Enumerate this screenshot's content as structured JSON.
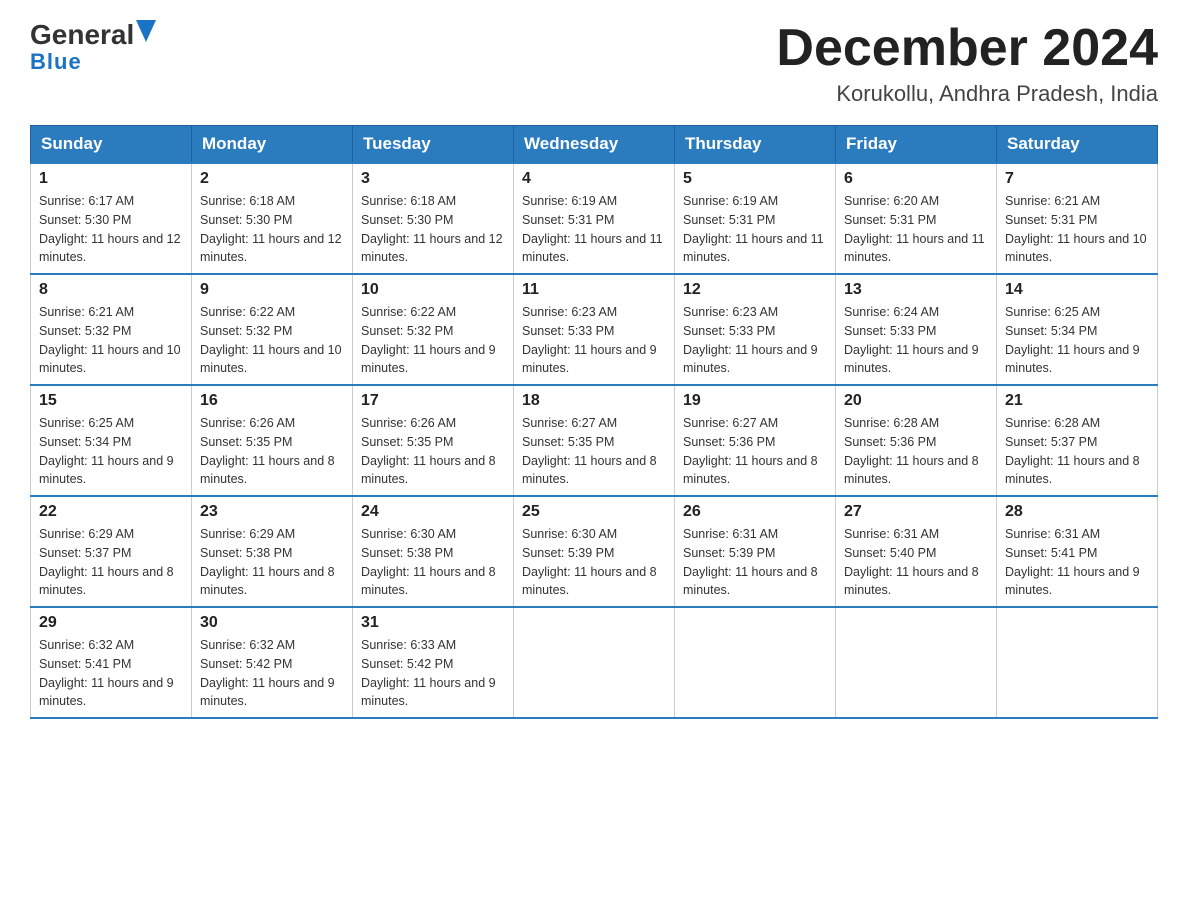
{
  "header": {
    "logo_general": "General",
    "logo_blue": "Blue",
    "month_title": "December 2024",
    "location": "Korukollu, Andhra Pradesh, India"
  },
  "days_of_week": [
    "Sunday",
    "Monday",
    "Tuesday",
    "Wednesday",
    "Thursday",
    "Friday",
    "Saturday"
  ],
  "weeks": [
    [
      {
        "day": "1",
        "sunrise": "6:17 AM",
        "sunset": "5:30 PM",
        "daylight": "11 hours and 12 minutes."
      },
      {
        "day": "2",
        "sunrise": "6:18 AM",
        "sunset": "5:30 PM",
        "daylight": "11 hours and 12 minutes."
      },
      {
        "day": "3",
        "sunrise": "6:18 AM",
        "sunset": "5:30 PM",
        "daylight": "11 hours and 12 minutes."
      },
      {
        "day": "4",
        "sunrise": "6:19 AM",
        "sunset": "5:31 PM",
        "daylight": "11 hours and 11 minutes."
      },
      {
        "day": "5",
        "sunrise": "6:19 AM",
        "sunset": "5:31 PM",
        "daylight": "11 hours and 11 minutes."
      },
      {
        "day": "6",
        "sunrise": "6:20 AM",
        "sunset": "5:31 PM",
        "daylight": "11 hours and 11 minutes."
      },
      {
        "day": "7",
        "sunrise": "6:21 AM",
        "sunset": "5:31 PM",
        "daylight": "11 hours and 10 minutes."
      }
    ],
    [
      {
        "day": "8",
        "sunrise": "6:21 AM",
        "sunset": "5:32 PM",
        "daylight": "11 hours and 10 minutes."
      },
      {
        "day": "9",
        "sunrise": "6:22 AM",
        "sunset": "5:32 PM",
        "daylight": "11 hours and 10 minutes."
      },
      {
        "day": "10",
        "sunrise": "6:22 AM",
        "sunset": "5:32 PM",
        "daylight": "11 hours and 9 minutes."
      },
      {
        "day": "11",
        "sunrise": "6:23 AM",
        "sunset": "5:33 PM",
        "daylight": "11 hours and 9 minutes."
      },
      {
        "day": "12",
        "sunrise": "6:23 AM",
        "sunset": "5:33 PM",
        "daylight": "11 hours and 9 minutes."
      },
      {
        "day": "13",
        "sunrise": "6:24 AM",
        "sunset": "5:33 PM",
        "daylight": "11 hours and 9 minutes."
      },
      {
        "day": "14",
        "sunrise": "6:25 AM",
        "sunset": "5:34 PM",
        "daylight": "11 hours and 9 minutes."
      }
    ],
    [
      {
        "day": "15",
        "sunrise": "6:25 AM",
        "sunset": "5:34 PM",
        "daylight": "11 hours and 9 minutes."
      },
      {
        "day": "16",
        "sunrise": "6:26 AM",
        "sunset": "5:35 PM",
        "daylight": "11 hours and 8 minutes."
      },
      {
        "day": "17",
        "sunrise": "6:26 AM",
        "sunset": "5:35 PM",
        "daylight": "11 hours and 8 minutes."
      },
      {
        "day": "18",
        "sunrise": "6:27 AM",
        "sunset": "5:35 PM",
        "daylight": "11 hours and 8 minutes."
      },
      {
        "day": "19",
        "sunrise": "6:27 AM",
        "sunset": "5:36 PM",
        "daylight": "11 hours and 8 minutes."
      },
      {
        "day": "20",
        "sunrise": "6:28 AM",
        "sunset": "5:36 PM",
        "daylight": "11 hours and 8 minutes."
      },
      {
        "day": "21",
        "sunrise": "6:28 AM",
        "sunset": "5:37 PM",
        "daylight": "11 hours and 8 minutes."
      }
    ],
    [
      {
        "day": "22",
        "sunrise": "6:29 AM",
        "sunset": "5:37 PM",
        "daylight": "11 hours and 8 minutes."
      },
      {
        "day": "23",
        "sunrise": "6:29 AM",
        "sunset": "5:38 PM",
        "daylight": "11 hours and 8 minutes."
      },
      {
        "day": "24",
        "sunrise": "6:30 AM",
        "sunset": "5:38 PM",
        "daylight": "11 hours and 8 minutes."
      },
      {
        "day": "25",
        "sunrise": "6:30 AM",
        "sunset": "5:39 PM",
        "daylight": "11 hours and 8 minutes."
      },
      {
        "day": "26",
        "sunrise": "6:31 AM",
        "sunset": "5:39 PM",
        "daylight": "11 hours and 8 minutes."
      },
      {
        "day": "27",
        "sunrise": "6:31 AM",
        "sunset": "5:40 PM",
        "daylight": "11 hours and 8 minutes."
      },
      {
        "day": "28",
        "sunrise": "6:31 AM",
        "sunset": "5:41 PM",
        "daylight": "11 hours and 9 minutes."
      }
    ],
    [
      {
        "day": "29",
        "sunrise": "6:32 AM",
        "sunset": "5:41 PM",
        "daylight": "11 hours and 9 minutes."
      },
      {
        "day": "30",
        "sunrise": "6:32 AM",
        "sunset": "5:42 PM",
        "daylight": "11 hours and 9 minutes."
      },
      {
        "day": "31",
        "sunrise": "6:33 AM",
        "sunset": "5:42 PM",
        "daylight": "11 hours and 9 minutes."
      },
      null,
      null,
      null,
      null
    ]
  ]
}
